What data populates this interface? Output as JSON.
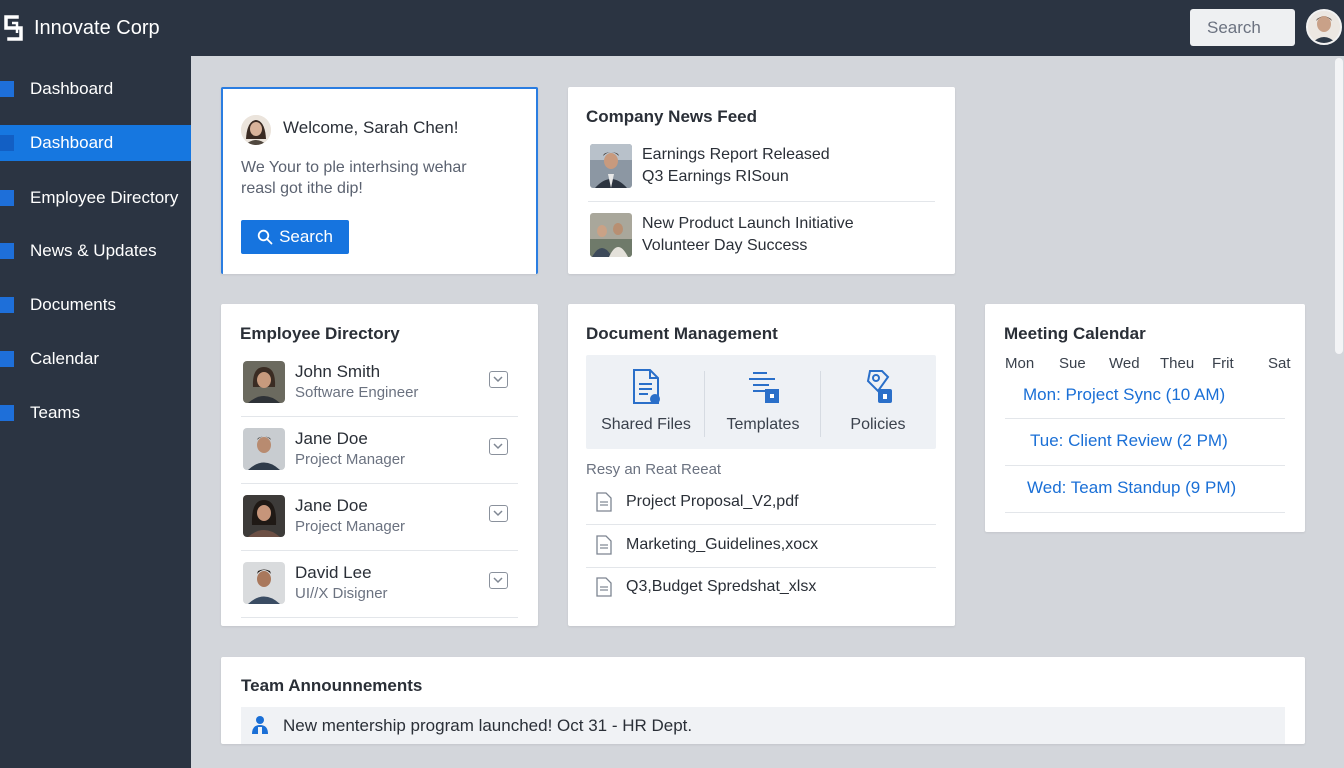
{
  "app": {
    "name": "Innovate Corp"
  },
  "header": {
    "search_placeholder": "Search",
    "avatar_icon": "user-avatar"
  },
  "sidebar": {
    "items": [
      {
        "label": "Dashboard",
        "active": false
      },
      {
        "label": "Dashboard",
        "active": true
      },
      {
        "label": "Employee Directory",
        "active": false
      },
      {
        "label": "News & Updates",
        "active": false
      },
      {
        "label": "Documents",
        "active": false
      },
      {
        "label": "Calendar",
        "active": false
      },
      {
        "label": "Teams",
        "active": false
      }
    ]
  },
  "welcome": {
    "greeting": "Welcome, Sarah Chen!",
    "line1": "We Your to ple interhsing wehar",
    "line2": "reasl got ithe dip!",
    "button_label": "Search"
  },
  "news": {
    "title": "Company News Feed",
    "items": [
      {
        "line1": "Earnings Report Released",
        "line2": "Q3 Earnings RISoun"
      },
      {
        "line1": "New Product Launch Initiative",
        "line2": "Volunteer Day Success"
      }
    ]
  },
  "employees": {
    "title": "Employee Directory",
    "people": [
      {
        "name": "John Smith",
        "role": "Software Engineer"
      },
      {
        "name": "Jane Doe",
        "role": "Project Manager"
      },
      {
        "name": "Jane Doe",
        "role": "Project Manager"
      },
      {
        "name": "David Lee",
        "role": "UI//X Disigner"
      }
    ]
  },
  "documents": {
    "title": "Document Management",
    "tiles": [
      {
        "label": "Shared Files",
        "icon": "shared-files-icon"
      },
      {
        "label": "Templates",
        "icon": "templates-icon"
      },
      {
        "label": "Policies",
        "icon": "policies-icon"
      }
    ],
    "recent_header": "Resy an Reat Reeat",
    "files": [
      "Project Proposal_V2,pdf",
      "Marketing_Guidelines,xocx",
      "Q3,Budget Spredshat_xlsx"
    ]
  },
  "calendar": {
    "title": "Meeting Calendar",
    "days": [
      "Mon",
      "Sue",
      "Wed",
      "Theu",
      "Frit",
      "Sat"
    ],
    "events": [
      "Mon: Project Sync (10 AM)",
      "Tue: Client Review (2 PM)",
      "Wed: Team Standup (9 PM)"
    ]
  },
  "announcements": {
    "title": "Team Announnements",
    "items": [
      "New mentership program launched! Oct 31 - HR Dept."
    ]
  },
  "colors": {
    "accent": "#1674df",
    "sidebar": "#2b3442",
    "background": "#d3d6db",
    "link": "#1a6fd6"
  }
}
